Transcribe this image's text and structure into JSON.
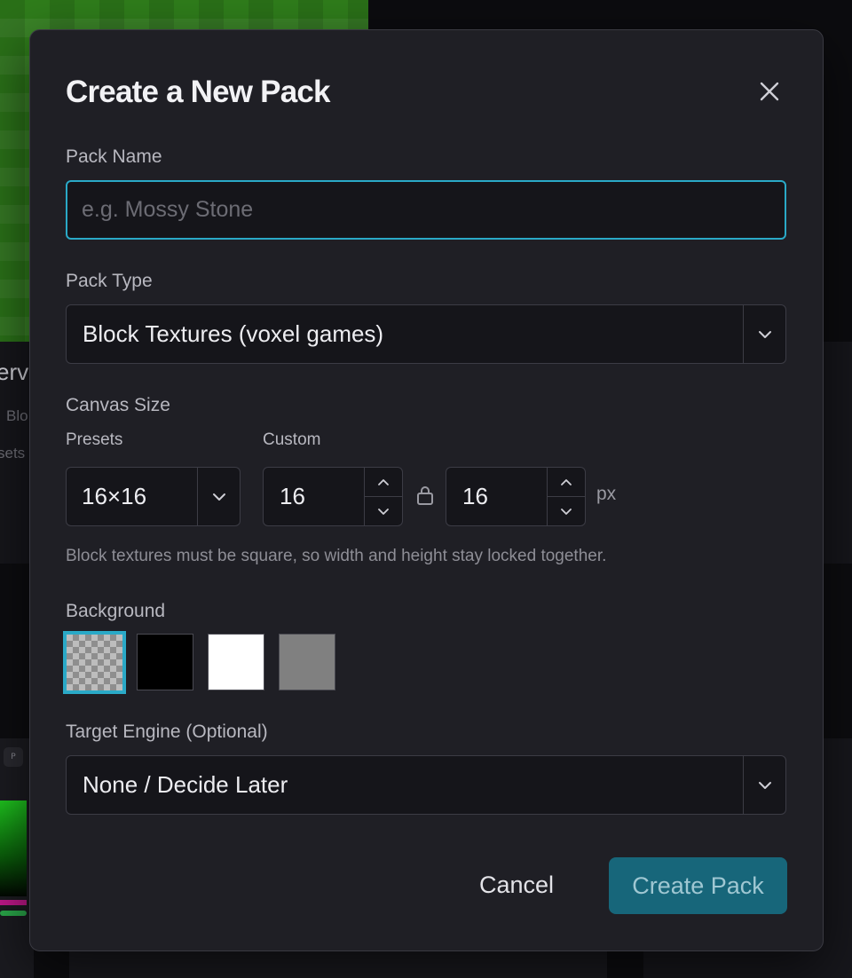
{
  "background": {
    "title_fragment": "erv",
    "sub_fragment_1": "Blo",
    "sub_fragment_2": "sets",
    "picker_chip": "P"
  },
  "dialog": {
    "title": "Create a New Pack",
    "close_icon": "close-icon",
    "pack_name": {
      "label": "Pack Name",
      "value": "",
      "placeholder": "e.g. Mossy Stone"
    },
    "pack_type": {
      "label": "Pack Type",
      "selected": "Block Textures (voxel games)"
    },
    "canvas_size": {
      "label": "Canvas Size",
      "presets_label": "Presets",
      "custom_label": "Custom",
      "preset_selected": "16×16",
      "width": "16",
      "height": "16",
      "unit": "px",
      "locked": true,
      "hint": "Block textures must be square, so width and height stay locked together."
    },
    "background": {
      "label": "Background",
      "options": [
        {
          "name": "transparent",
          "color": "transparent",
          "selected": true
        },
        {
          "name": "black",
          "color": "#000000",
          "selected": false
        },
        {
          "name": "white",
          "color": "#ffffff",
          "selected": false
        },
        {
          "name": "gray",
          "color": "#808080",
          "selected": false
        }
      ]
    },
    "target_engine": {
      "label": "Target Engine (Optional)",
      "selected": "None / Decide Later"
    },
    "actions": {
      "cancel_label": "Cancel",
      "create_label": "Create Pack"
    }
  },
  "colors": {
    "accent": "#2aa9c7",
    "primary_button": "#17667a",
    "dialog_bg": "#1f1f25",
    "field_bg": "#15151a"
  }
}
